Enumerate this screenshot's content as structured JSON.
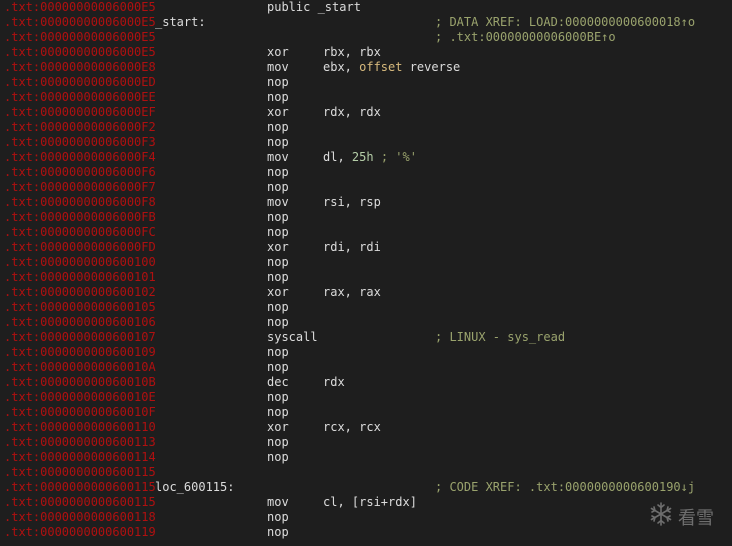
{
  "rows": [
    {
      "addr": ".txt:00000000006000E5",
      "label": "",
      "mnemonic": "public _start",
      "operands": "",
      "comment": ""
    },
    {
      "addr": ".txt:00000000006000E5",
      "label": "_start:",
      "mnemonic": "",
      "operands": "",
      "comment": "; DATA XREF: LOAD:0000000000600018↑o"
    },
    {
      "addr": ".txt:00000000006000E5",
      "label": "",
      "mnemonic": "",
      "operands": "",
      "comment": "; .txt:00000000006000BE↑o"
    },
    {
      "addr": ".txt:00000000006000E5",
      "label": "",
      "mnemonic": "xor",
      "operands": "rbx, rbx",
      "comment": ""
    },
    {
      "addr": ".txt:00000000006000E8",
      "label": "",
      "mnemonic": "mov",
      "operands": "ebx, offset reverse",
      "comment": ""
    },
    {
      "addr": ".txt:00000000006000ED",
      "label": "",
      "mnemonic": "nop",
      "operands": "",
      "comment": ""
    },
    {
      "addr": ".txt:00000000006000EE",
      "label": "",
      "mnemonic": "nop",
      "operands": "",
      "comment": ""
    },
    {
      "addr": ".txt:00000000006000EF",
      "label": "",
      "mnemonic": "xor",
      "operands": "rdx, rdx",
      "comment": ""
    },
    {
      "addr": ".txt:00000000006000F2",
      "label": "",
      "mnemonic": "nop",
      "operands": "",
      "comment": ""
    },
    {
      "addr": ".txt:00000000006000F3",
      "label": "",
      "mnemonic": "nop",
      "operands": "",
      "comment": ""
    },
    {
      "addr": ".txt:00000000006000F4",
      "label": "",
      "mnemonic": "mov",
      "operands": "dl, 25h ; '%'",
      "comment": ""
    },
    {
      "addr": ".txt:00000000006000F6",
      "label": "",
      "mnemonic": "nop",
      "operands": "",
      "comment": ""
    },
    {
      "addr": ".txt:00000000006000F7",
      "label": "",
      "mnemonic": "nop",
      "operands": "",
      "comment": ""
    },
    {
      "addr": ".txt:00000000006000F8",
      "label": "",
      "mnemonic": "mov",
      "operands": "rsi, rsp",
      "comment": ""
    },
    {
      "addr": ".txt:00000000006000FB",
      "label": "",
      "mnemonic": "nop",
      "operands": "",
      "comment": ""
    },
    {
      "addr": ".txt:00000000006000FC",
      "label": "",
      "mnemonic": "nop",
      "operands": "",
      "comment": ""
    },
    {
      "addr": ".txt:00000000006000FD",
      "label": "",
      "mnemonic": "xor",
      "operands": "rdi, rdi",
      "comment": ""
    },
    {
      "addr": ".txt:0000000000600100",
      "label": "",
      "mnemonic": "nop",
      "operands": "",
      "comment": ""
    },
    {
      "addr": ".txt:0000000000600101",
      "label": "",
      "mnemonic": "nop",
      "operands": "",
      "comment": ""
    },
    {
      "addr": ".txt:0000000000600102",
      "label": "",
      "mnemonic": "xor",
      "operands": "rax, rax",
      "comment": ""
    },
    {
      "addr": ".txt:0000000000600105",
      "label": "",
      "mnemonic": "nop",
      "operands": "",
      "comment": ""
    },
    {
      "addr": ".txt:0000000000600106",
      "label": "",
      "mnemonic": "nop",
      "operands": "",
      "comment": ""
    },
    {
      "addr": ".txt:0000000000600107",
      "label": "",
      "mnemonic": "syscall",
      "operands": "",
      "comment": "; LINUX - sys_read"
    },
    {
      "addr": ".txt:0000000000600109",
      "label": "",
      "mnemonic": "nop",
      "operands": "",
      "comment": ""
    },
    {
      "addr": ".txt:000000000060010A",
      "label": "",
      "mnemonic": "nop",
      "operands": "",
      "comment": ""
    },
    {
      "addr": ".txt:000000000060010B",
      "label": "",
      "mnemonic": "dec",
      "operands": "rdx",
      "comment": ""
    },
    {
      "addr": ".txt:000000000060010E",
      "label": "",
      "mnemonic": "nop",
      "operands": "",
      "comment": ""
    },
    {
      "addr": ".txt:000000000060010F",
      "label": "",
      "mnemonic": "nop",
      "operands": "",
      "comment": ""
    },
    {
      "addr": ".txt:0000000000600110",
      "label": "",
      "mnemonic": "xor",
      "operands": "rcx, rcx",
      "comment": ""
    },
    {
      "addr": ".txt:0000000000600113",
      "label": "",
      "mnemonic": "nop",
      "operands": "",
      "comment": ""
    },
    {
      "addr": ".txt:0000000000600114",
      "label": "",
      "mnemonic": "nop",
      "operands": "",
      "comment": ""
    },
    {
      "addr": ".txt:0000000000600115",
      "label": "",
      "mnemonic": "",
      "operands": "",
      "comment": ""
    },
    {
      "addr": ".txt:0000000000600115",
      "label": "loc_600115:",
      "mnemonic": "",
      "operands": "",
      "comment": "; CODE XREF: .txt:0000000000600190↓j"
    },
    {
      "addr": ".txt:0000000000600115",
      "label": "",
      "mnemonic": "mov",
      "operands": "cl, [rsi+rdx]",
      "comment": ""
    },
    {
      "addr": ".txt:0000000000600118",
      "label": "",
      "mnemonic": "nop",
      "operands": "",
      "comment": ""
    },
    {
      "addr": ".txt:0000000000600119",
      "label": "",
      "mnemonic": "nop",
      "operands": "",
      "comment": ""
    }
  ],
  "watermark": {
    "text": "看雪",
    "icon": "snowflake-icon"
  },
  "colors": {
    "background": "#1e1e1e",
    "address": "#b01010",
    "text": "#dcdcdc",
    "comment": "#9aa36d",
    "immediate": "#b5cea8"
  }
}
